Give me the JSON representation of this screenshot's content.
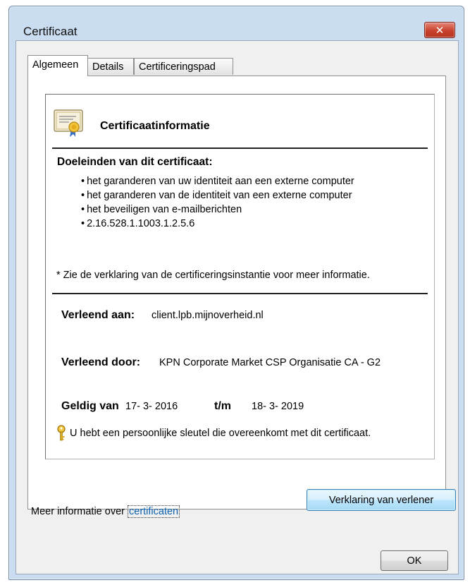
{
  "window": {
    "title": "Certificaat",
    "close_glyph": "✕"
  },
  "tabs": [
    {
      "label": "Algemeen",
      "active": true
    },
    {
      "label": "Details",
      "active": false
    },
    {
      "label": "Certificeringspad",
      "active": false
    }
  ],
  "certificate": {
    "icon": "certificate-icon",
    "heading": "Certificaatinformatie",
    "purpose_heading": "Doeleinden van dit certificaat:",
    "purposes": [
      "het garanderen van uw identiteit aan een externe computer",
      "het garanderen van de identiteit van een externe computer",
      "het beveiligen van e-mailberichten",
      "2.16.528.1.1003.1.2.5.6"
    ],
    "note": "* Zie de verklaring van de certificeringsinstantie voor meer informatie.",
    "issued_to_label": "Verleend aan:",
    "issued_to_value": "client.lpb.mijnoverheid.nl",
    "issued_by_label": "Verleend door:",
    "issued_by_value": "KPN Corporate Market CSP Organisatie CA - G2",
    "valid_from_label": "Geldig van",
    "valid_from_value": "17- 3- 2016",
    "valid_to_label": "t/m",
    "valid_to_value": "18- 3- 2019",
    "key_icon": "key-icon",
    "key_note": "U hebt een persoonlijke sleutel die overeenkomt met dit certificaat."
  },
  "buttons": {
    "issuer_statement": "Verklaring van verlener",
    "ok": "OK"
  },
  "footer": {
    "more_info_text": "Meer informatie over",
    "more_info_link": "certificaten"
  }
}
